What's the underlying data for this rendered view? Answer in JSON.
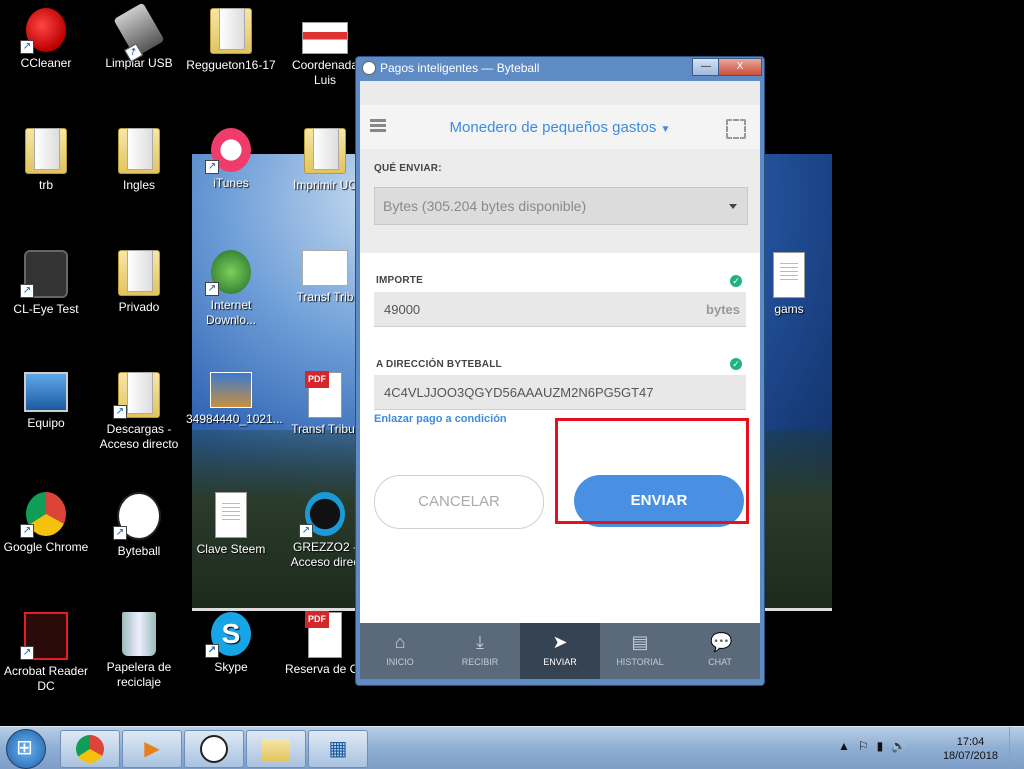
{
  "desktop": {
    "icons": [
      {
        "label": "CCleaner"
      },
      {
        "label": "Limpiar USB"
      },
      {
        "label": "Reggueton16-17"
      },
      {
        "label": "Coordenada Luis"
      },
      {
        "label": "trb"
      },
      {
        "label": "Ingles"
      },
      {
        "label": "iTunes"
      },
      {
        "label": "Imprimir UC"
      },
      {
        "label": "CL-Eye Test"
      },
      {
        "label": "Privado"
      },
      {
        "label": "Internet Downlo..."
      },
      {
        "label": "Transf Trib"
      },
      {
        "label": "gams"
      },
      {
        "label": "Equipo"
      },
      {
        "label": "Descargas - Acceso directo"
      },
      {
        "label": "34984440_1021..."
      },
      {
        "label": "Transf Tribur"
      },
      {
        "label": "Google Chrome"
      },
      {
        "label": "Byteball"
      },
      {
        "label": "Clave Steem"
      },
      {
        "label": "GREZZO2 - Acceso direc"
      },
      {
        "label": "Acrobat Reader DC"
      },
      {
        "label": "Papelera de reciclaje"
      },
      {
        "label": "Skype"
      },
      {
        "label": "Reserva de Cu"
      }
    ],
    "pdf_tag": "PDF"
  },
  "window": {
    "title": "Pagos inteligentes — Byteball",
    "minimize": "—",
    "close": "X"
  },
  "app": {
    "wallet_name": "Monedero de pequeños gastos",
    "what_to_send_label": "QUÉ ENVIAR:",
    "asset_select_value": "Bytes (305.204 bytes disponible)",
    "amount_label": "IMPORTE",
    "amount_value": "49000",
    "amount_unit": "bytes",
    "address_label": "A DIRECCIÓN BYTEBALL",
    "address_value": "4C4VLJJOO3QGYD56AAAUZM2N6PG5GT47",
    "conditional_link": "Enlazar pago a condición",
    "cancel_button": "CANCELAR",
    "send_button": "ENVIAR",
    "tabs": [
      {
        "label": "INICIO",
        "icon": "home-icon"
      },
      {
        "label": "RECIBIR",
        "icon": "download-icon"
      },
      {
        "label": "ENVIAR",
        "icon": "send-icon",
        "active": true
      },
      {
        "label": "HISTORIAL",
        "icon": "history-icon"
      },
      {
        "label": "CHAT",
        "icon": "chat-icon"
      }
    ],
    "accent_color": "#4a90e2"
  },
  "taskbar": {
    "time": "17:04",
    "date": "18/07/2018"
  }
}
